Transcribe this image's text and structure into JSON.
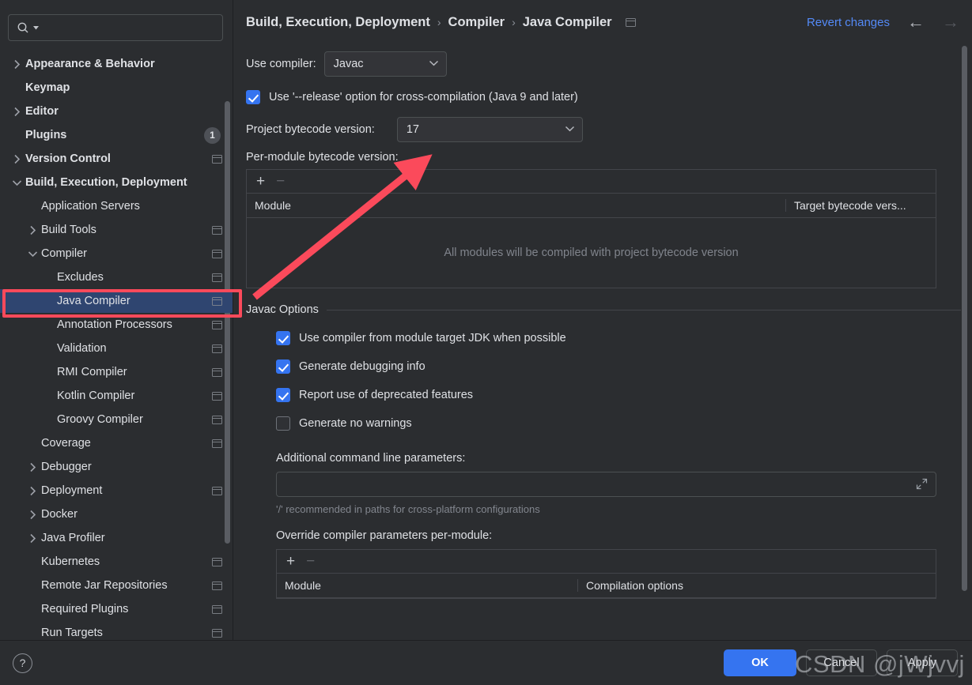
{
  "search": {
    "placeholder": "",
    "value": "",
    "icon": "search-icon"
  },
  "sidebar": {
    "items": [
      {
        "label": "Appearance & Behavior",
        "indent": 0,
        "twisty": "collapsed",
        "bold": true,
        "project_icon": false,
        "badge": null,
        "selected": false
      },
      {
        "label": "Keymap",
        "indent": 0,
        "twisty": "none",
        "bold": true,
        "project_icon": false,
        "badge": null,
        "selected": false
      },
      {
        "label": "Editor",
        "indent": 0,
        "twisty": "collapsed",
        "bold": true,
        "project_icon": false,
        "badge": null,
        "selected": false
      },
      {
        "label": "Plugins",
        "indent": 0,
        "twisty": "none",
        "bold": true,
        "project_icon": false,
        "badge": "1",
        "selected": false
      },
      {
        "label": "Version Control",
        "indent": 0,
        "twisty": "collapsed",
        "bold": true,
        "project_icon": true,
        "badge": null,
        "selected": false
      },
      {
        "label": "Build, Execution, Deployment",
        "indent": 0,
        "twisty": "expanded",
        "bold": true,
        "project_icon": false,
        "badge": null,
        "selected": false
      },
      {
        "label": "Application Servers",
        "indent": 1,
        "twisty": "none",
        "bold": false,
        "project_icon": false,
        "badge": null,
        "selected": false
      },
      {
        "label": "Build Tools",
        "indent": 1,
        "twisty": "collapsed",
        "bold": false,
        "project_icon": true,
        "badge": null,
        "selected": false
      },
      {
        "label": "Compiler",
        "indent": 1,
        "twisty": "expanded",
        "bold": false,
        "project_icon": true,
        "badge": null,
        "selected": false
      },
      {
        "label": "Excludes",
        "indent": 2,
        "twisty": "none",
        "bold": false,
        "project_icon": true,
        "badge": null,
        "selected": false
      },
      {
        "label": "Java Compiler",
        "indent": 2,
        "twisty": "none",
        "bold": false,
        "project_icon": true,
        "badge": null,
        "selected": true
      },
      {
        "label": "Annotation Processors",
        "indent": 2,
        "twisty": "none",
        "bold": false,
        "project_icon": true,
        "badge": null,
        "selected": false
      },
      {
        "label": "Validation",
        "indent": 2,
        "twisty": "none",
        "bold": false,
        "project_icon": true,
        "badge": null,
        "selected": false
      },
      {
        "label": "RMI Compiler",
        "indent": 2,
        "twisty": "none",
        "bold": false,
        "project_icon": true,
        "badge": null,
        "selected": false
      },
      {
        "label": "Kotlin Compiler",
        "indent": 2,
        "twisty": "none",
        "bold": false,
        "project_icon": true,
        "badge": null,
        "selected": false
      },
      {
        "label": "Groovy Compiler",
        "indent": 2,
        "twisty": "none",
        "bold": false,
        "project_icon": true,
        "badge": null,
        "selected": false
      },
      {
        "label": "Coverage",
        "indent": 1,
        "twisty": "none",
        "bold": false,
        "project_icon": true,
        "badge": null,
        "selected": false
      },
      {
        "label": "Debugger",
        "indent": 1,
        "twisty": "collapsed",
        "bold": false,
        "project_icon": false,
        "badge": null,
        "selected": false
      },
      {
        "label": "Deployment",
        "indent": 1,
        "twisty": "collapsed",
        "bold": false,
        "project_icon": true,
        "badge": null,
        "selected": false
      },
      {
        "label": "Docker",
        "indent": 1,
        "twisty": "collapsed",
        "bold": false,
        "project_icon": false,
        "badge": null,
        "selected": false
      },
      {
        "label": "Java Profiler",
        "indent": 1,
        "twisty": "collapsed",
        "bold": false,
        "project_icon": false,
        "badge": null,
        "selected": false
      },
      {
        "label": "Kubernetes",
        "indent": 1,
        "twisty": "none",
        "bold": false,
        "project_icon": true,
        "badge": null,
        "selected": false
      },
      {
        "label": "Remote Jar Repositories",
        "indent": 1,
        "twisty": "none",
        "bold": false,
        "project_icon": true,
        "badge": null,
        "selected": false
      },
      {
        "label": "Required Plugins",
        "indent": 1,
        "twisty": "none",
        "bold": false,
        "project_icon": true,
        "badge": null,
        "selected": false
      },
      {
        "label": "Run Targets",
        "indent": 1,
        "twisty": "none",
        "bold": false,
        "project_icon": true,
        "badge": null,
        "selected": false
      }
    ]
  },
  "header": {
    "breadcrumb": [
      "Build, Execution, Deployment",
      "Compiler",
      "Java Compiler"
    ],
    "separator": "›",
    "project_icon": "project-scope-icon",
    "revert_label": "Revert changes",
    "back_icon": "←",
    "forward_icon": "→"
  },
  "main": {
    "use_compiler_label": "Use compiler:",
    "use_compiler_value": "Javac",
    "release_option_label": "Use '--release' option for cross-compilation (Java 9 and later)",
    "release_option_checked": true,
    "project_bytecode_label": "Project bytecode version:",
    "project_bytecode_value": "17",
    "per_module_label": "Per-module bytecode version:",
    "per_module_table": {
      "add_icon": "+",
      "remove_icon": "−",
      "columns": [
        "Module",
        "Target bytecode vers..."
      ],
      "empty_text": "All modules will be compiled with project bytecode version",
      "rows": []
    },
    "javac_section_title": "Javac Options",
    "javac_options": [
      {
        "label": "Use compiler from module target JDK when possible",
        "checked": true
      },
      {
        "label": "Generate debugging info",
        "checked": true
      },
      {
        "label": "Report use of deprecated features",
        "checked": true
      },
      {
        "label": "Generate no warnings",
        "checked": false
      }
    ],
    "additional_params_label": "Additional command line parameters:",
    "additional_params_value": "",
    "additional_params_hint": "'/' recommended in paths for cross-platform configurations",
    "expand_icon": "⤡",
    "override_label": "Override compiler parameters per-module:",
    "override_table": {
      "add_icon": "+",
      "remove_icon": "−",
      "columns": [
        "Module",
        "Compilation options"
      ],
      "rows": []
    }
  },
  "footer": {
    "help_label": "?",
    "ok_label": "OK",
    "cancel_label": "Cancel",
    "apply_label": "Apply"
  },
  "annotations": {
    "highlight_color": "#fb4a5b",
    "arrow_color": "#fb4a5b",
    "watermark_text": "CSDN @jWjvvj"
  },
  "colors": {
    "accent": "#3574f0",
    "link": "#548af7",
    "selection": "#2f4570",
    "background": "#2b2d30",
    "border": "#43454a",
    "text": "#dfe1e5",
    "muted": "#82868e"
  }
}
